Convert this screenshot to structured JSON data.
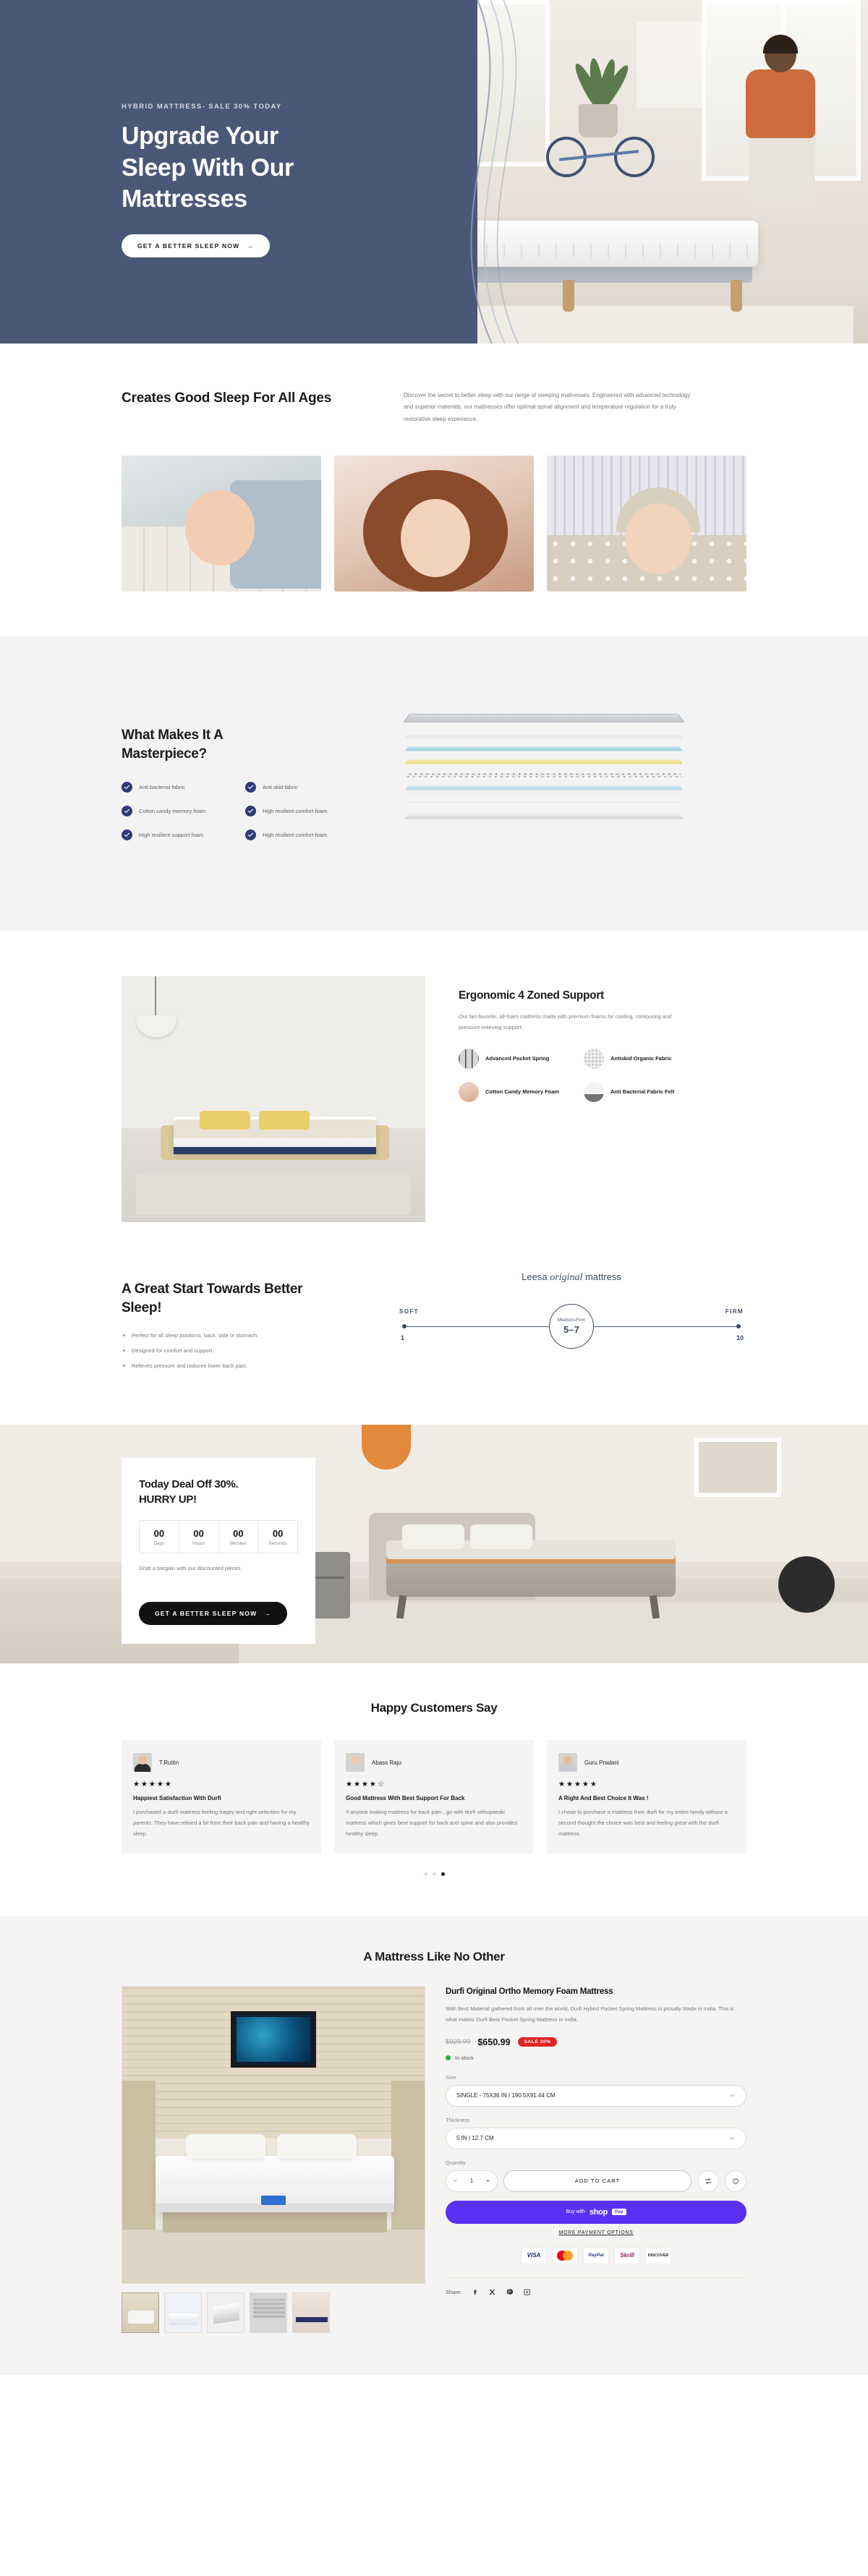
{
  "hero": {
    "eyebrow": "HYBRID MATTRESS- SALE 30% TODAY",
    "title_line1": "Upgrade Your",
    "title_line2": "Sleep With Our",
    "title_line3": "Mattresses",
    "cta": "GET A BETTER SLEEP NOW",
    "cta_arrow": "→",
    "bg_color": "#485876"
  },
  "ages": {
    "title": "Creates Good Sleep For All Ages",
    "description": "Discover the secret to better sleep with our range of sleeping mattresses. Engineered with advanced technology and superior materials, our mattresses offer optimal spinal alignment and temperature regulation for a truly restorative sleep experience."
  },
  "masterpiece": {
    "title_line1": "What Makes It A",
    "title_line2": "Masterpiece?",
    "features": [
      "Anti bacterial fabric",
      "Anti skid fabric",
      "Cotton candy memory foam",
      "High resilient comfort foam",
      "High resilient support foam",
      "High resilient comfort foam"
    ],
    "check_color": "#2f3a7a"
  },
  "ergonomic": {
    "title": "Ergonomic 4 Zoned Support",
    "description": "Our fan-favorite, all-foam mattress made with premium foams for cooling, contouring and pressure-relieving support.",
    "features": [
      {
        "label": "Advanced Pocket Spring",
        "icon": "pocket-spring-icon"
      },
      {
        "label": "Antiskid Organic Fabric",
        "icon": "antiskid-fabric-icon"
      },
      {
        "label": "Cotton Candy Memory Foam",
        "icon": "cotton-candy-icon"
      },
      {
        "label": "Anti Bacterial Fabric Felt",
        "icon": "felt-icon"
      }
    ]
  },
  "great_start": {
    "title_line1": "A Great Start Towards Better",
    "title_line2": "Sleep!",
    "bullets": [
      "Perfect for all sleep positions, back, side or stomach.",
      "Designed for comfort and support.",
      "Relieves pressure and reduces lower back pain."
    ],
    "firmness": {
      "brand": "Leesa",
      "brand_italic": "original",
      "brand_tail": "mattress",
      "left_label": "SOFT",
      "right_label": "FIRM",
      "left_value": "1",
      "right_value": "10",
      "caption": "Medium-Firm",
      "value": "5–7"
    }
  },
  "deal": {
    "title_line1": "Today Deal Off 30%.",
    "title_line2": "HURRY UP!",
    "counters": [
      {
        "value": "00",
        "label": "Days"
      },
      {
        "value": "00",
        "label": "Hours"
      },
      {
        "value": "00",
        "label": "Minutes"
      },
      {
        "value": "00",
        "label": "Seconds"
      }
    ],
    "subtitle": "Grab a bargain with our discounted pieces",
    "cta": "GET A BETTER SLEEP NOW",
    "cta_arrow": "→"
  },
  "testimonials": {
    "title": "Happy Customers Say",
    "items": [
      {
        "name": "T.Ruttin",
        "stars": "★★★★★",
        "heading": "Happiest Satisfaction With Durfi",
        "body": "I purchased a durfi mattress feeling happy and right selection for my parents. They have relived a bit from their back pain and having a healthy sleep."
      },
      {
        "name": "Abass Raju",
        "stars": "★★★★☆",
        "heading": "Good Mattress With Best Support For Back",
        "body": "If anyone looking mattress for back pain , go with durfi orthopaedic mattress which gives best support for back and spine and also provides healthy sleep."
      },
      {
        "name": "Guru Pradani",
        "stars": "★★★★★",
        "heading": "A Right And Best Choice It Was !",
        "body": "I chose to purchase a mattress from durfi for my entire family without a second thought the choice was best and feeling great with the durfi mattress."
      }
    ],
    "dots": [
      false,
      false,
      true
    ]
  },
  "product": {
    "section_title": "A Mattress Like No Other",
    "name": "Durfi Original Ortho Memory Foam Mattress",
    "description": "With Best Material gathered from all over the world, Durfi Hybird Pocket Spring Mattress is proudly Made in India. This is what makes Durfi Best Pocket Spring Mattress in India.",
    "price_old": "$929.99",
    "price_new": "$650.99",
    "sale_badge": "SALE 30%",
    "sale_color": "#e02424",
    "stock": "In stock",
    "stock_color": "#22b14c",
    "size_label": "Size",
    "size_value": "SINGLE - 75X36 IN I 190.5X91.44 CM",
    "thickness_label": "Thickness",
    "thickness_value": "5 IN I 12.7 CM",
    "quantity_label": "Quantity",
    "quantity_value": "1",
    "qty_minus": "−",
    "qty_plus": "+",
    "add_to_cart": "ADD TO CART",
    "shop_pay_prefix": "Buy with",
    "shop_pay_brand": "shop",
    "shop_pay_suffix": "Pay",
    "shop_pay_color": "#5a31f4",
    "more_payment": "MORE PAYMENT OPTIONS",
    "payment_logos": [
      "VISA",
      "Mastercard",
      "PayPal",
      "Skrill",
      "DISCOVER"
    ],
    "share_label": "Share:",
    "share_icons": [
      "facebook-icon",
      "x-twitter-icon",
      "pinterest-icon",
      "copy-link-icon"
    ]
  }
}
